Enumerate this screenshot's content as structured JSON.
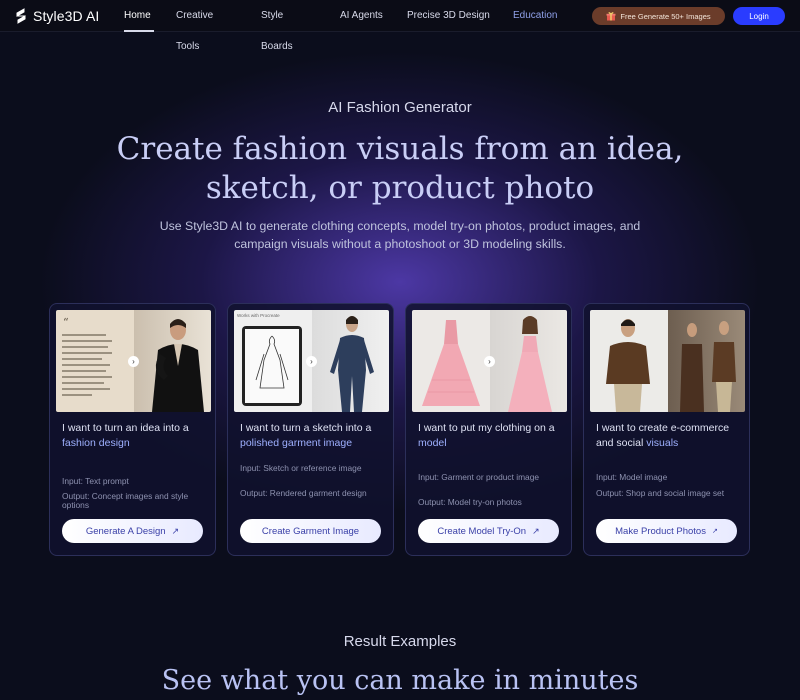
{
  "nav": {
    "brand": "Style3D AI",
    "links": [
      {
        "label": "Home",
        "active": true
      },
      {
        "label": "Creative Tools"
      },
      {
        "label": "Style Boards"
      },
      {
        "label": "AI Agents"
      },
      {
        "label": "Precise 3D Design"
      },
      {
        "label": "Education",
        "highlight": true
      }
    ],
    "promo_label": "Free Generate 50+ Images",
    "login_label": "Login"
  },
  "hero": {
    "eyebrow": "AI Fashion Generator",
    "headline": "Create fashion visuals from an idea, sketch, or product photo",
    "subtext": "Use Style3D AI to generate clothing concepts, model try-on photos, product images, and campaign visuals without a photoshoot or 3D modeling skills."
  },
  "cards": [
    {
      "title_prefix": "I want to turn an idea into a ",
      "title_highlight": "fashion design",
      "input": "Input: Text prompt",
      "output": "Output: Concept images and style options",
      "button": "Generate A Design"
    },
    {
      "title_prefix": "I want to turn a sketch into a ",
      "title_highlight": "polished garment image",
      "input": "Input: Sketch or reference image",
      "output": "Output: Rendered garment design",
      "button": "Create Garment Image",
      "image_label": "Works with Procreate"
    },
    {
      "title_prefix": "I want to put my clothing on a ",
      "title_highlight": "model",
      "input": "Input: Garment or product image",
      "output": "Output: Model try-on photos",
      "button": "Create Model Try-On"
    },
    {
      "title_prefix": "I want to create e-commerce and social ",
      "title_highlight": "visuals",
      "input": "Input: Model image",
      "output": "Output: Shop and social image set",
      "button": "Make Product Photos"
    }
  ],
  "results": {
    "eyebrow": "Result Examples",
    "title": "See what you can make in minutes"
  }
}
